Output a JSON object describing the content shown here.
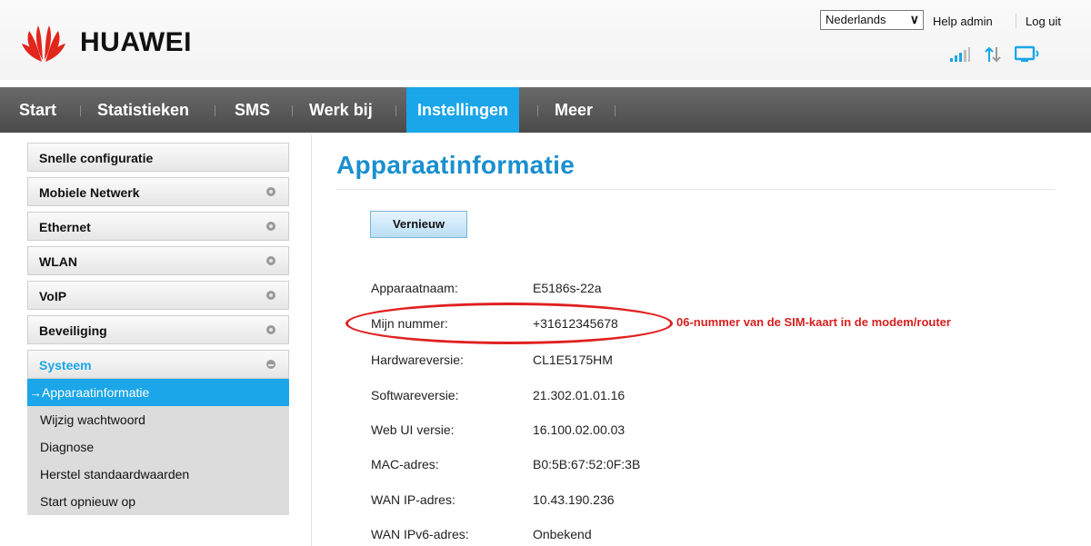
{
  "header": {
    "brand": "HUAWEI",
    "language": "Nederlands",
    "help_label": "Help admin",
    "logout_label": "Log uit"
  },
  "nav": {
    "items": [
      {
        "label": "Start"
      },
      {
        "label": "Statistieken"
      },
      {
        "label": "SMS"
      },
      {
        "label": "Werk bij"
      },
      {
        "label": "Instellingen",
        "active": true
      },
      {
        "label": "Meer"
      }
    ],
    "active_color": "#1aa6e8"
  },
  "sidebar": {
    "items": [
      {
        "label": "Snelle configuratie"
      },
      {
        "label": "Mobiele Netwerk"
      },
      {
        "label": "Ethernet"
      },
      {
        "label": "WLAN"
      },
      {
        "label": "VoIP"
      },
      {
        "label": "Beveiliging"
      },
      {
        "label": "Systeem",
        "expanded": true
      }
    ],
    "subitems": [
      {
        "label": "Apparaatinformatie",
        "active": true
      },
      {
        "label": "Wijzig wachtwoord"
      },
      {
        "label": "Diagnose"
      },
      {
        "label": "Herstel standaardwaarden"
      },
      {
        "label": "Start opnieuw op"
      }
    ]
  },
  "main": {
    "title": "Apparaatinformatie",
    "refresh_label": "Vernieuw",
    "rows": [
      {
        "label": "Apparaatnaam:",
        "value": "E5186s-22a"
      },
      {
        "label": "Mijn nummer:",
        "value": "+31612345678"
      },
      {
        "label": "Hardwareversie:",
        "value": "CL1E5175HM"
      },
      {
        "label": "Softwareversie:",
        "value": "21.302.01.01.16"
      },
      {
        "label": "Web UI versie:",
        "value": "16.100.02.00.03"
      },
      {
        "label": "MAC-adres:",
        "value": "B0:5B:67:52:0F:3B"
      },
      {
        "label": "WAN IP-adres:",
        "value": "10.43.190.236"
      },
      {
        "label": "WAN IPv6-adres:",
        "value": "Onbekend"
      }
    ],
    "annotation": "06-nummer van de SIM-kaart in de modem/router"
  },
  "colors": {
    "accent": "#1aa6e8",
    "title": "#1a8fcf",
    "annotation": "#d62020",
    "brand_red": "#e1261c"
  },
  "icons": [
    "huawei-logo-icon",
    "signal-strength-icon",
    "data-transfer-icon",
    "connection-monitor-icon",
    "chevron-down-icon",
    "expand-circle-icon",
    "arrow-right-icon"
  ]
}
